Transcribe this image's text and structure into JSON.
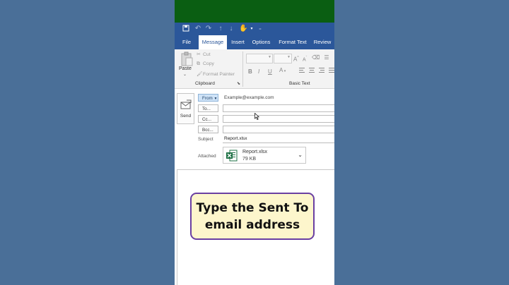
{
  "colors": {
    "outer_background": "#4a6f98",
    "top_band": "#0a5e12",
    "ribbon_blue": "#2b579a",
    "callout_fill": "#fdf6cc",
    "callout_border": "#6a3fa2",
    "excel_green": "#1e7145"
  },
  "quick_access": {
    "icons": [
      "save-icon",
      "undo-icon",
      "redo-icon",
      "up-arrow-icon",
      "down-arrow-icon",
      "touch-mode-icon",
      "customize-icon"
    ]
  },
  "tabs": [
    {
      "label": "File",
      "active": false
    },
    {
      "label": "Message",
      "active": true
    },
    {
      "label": "Insert",
      "active": false
    },
    {
      "label": "Options",
      "active": false
    },
    {
      "label": "Format Text",
      "active": false
    },
    {
      "label": "Review",
      "active": false
    }
  ],
  "ribbon": {
    "clipboard": {
      "paste_label": "Paste",
      "cut_label": "Cut",
      "copy_label": "Copy",
      "format_painter_label": "Format Painter",
      "group_label": "Clipboard"
    },
    "basic_text": {
      "group_label": "Basic Text",
      "bold": "B",
      "italic": "I",
      "underline": "U",
      "font_color": "A",
      "grow_font": "A",
      "shrink_font": "A"
    }
  },
  "compose": {
    "send_label": "Send",
    "from_label": "From",
    "from_value": "Example@example.com",
    "to_label": "To...",
    "to_value": "",
    "cc_label": "Cc...",
    "cc_value": "",
    "bcc_label": "Bcc...",
    "bcc_value": "",
    "subject_label": "Subject",
    "subject_value": "Report.xlsx",
    "attached_label": "Attached",
    "attachment": {
      "name": "Report.xlsx",
      "size": "79 KB",
      "icon": "excel-file-icon"
    }
  },
  "callout": {
    "line1": "Type the Sent To",
    "line2": "email address"
  }
}
